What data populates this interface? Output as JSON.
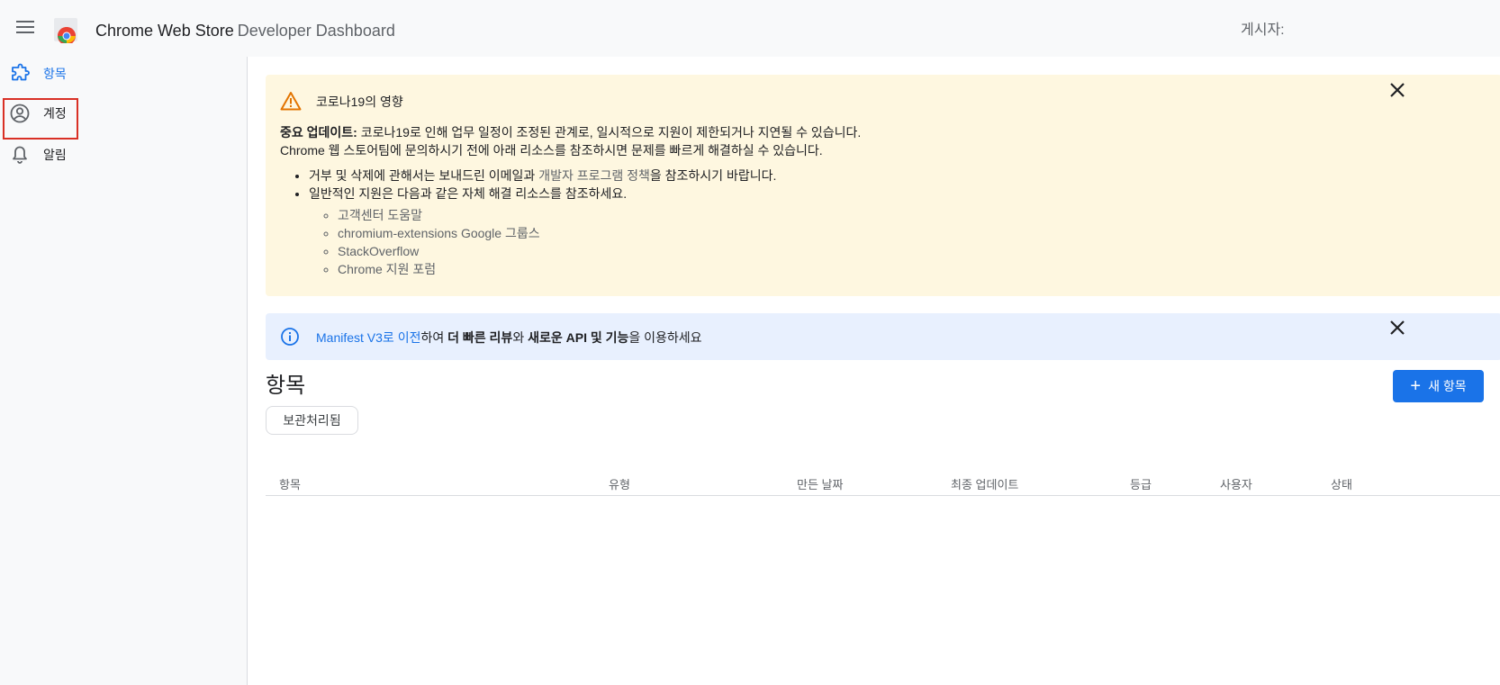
{
  "header": {
    "title": "Chrome Web Store",
    "subtitle": "Developer Dashboard",
    "publisher_label": "게시자:"
  },
  "sidebar": {
    "items": [
      {
        "label": "항목",
        "icon": "puzzle-icon",
        "active": true
      },
      {
        "label": "계정",
        "icon": "account-circle-icon",
        "active": false
      },
      {
        "label": "알림",
        "icon": "bell-icon",
        "active": false
      }
    ]
  },
  "covid_banner": {
    "title": "코로나19의 영향",
    "lead_bold": "중요 업데이트:",
    "lead_text": " 코로나19로 인해 업무 일정이 조정된 관계로, 일시적으로 지원이 제한되거나 지연될 수 있습니다.",
    "line2": "Chrome 웹 스토어팀에 문의하시기 전에 아래 리소스를 참조하시면 문제를 빠르게 해결하실 수 있습니다.",
    "bullet1_pre": "거부 및 삭제에 관해서는 보내드린 이메일과 ",
    "bullet1_link": "개발자 프로그램 정책",
    "bullet1_post": "을 참조하시기 바랍니다.",
    "bullet2": "일반적인 지원은 다음과 같은 자체 해결 리소스를 참조하세요.",
    "resources": [
      "고객센터 도움말",
      "chromium-extensions Google 그룹스",
      "StackOverflow",
      "Chrome 지원 포럼"
    ]
  },
  "mv3_banner": {
    "link": "Manifest V3로 이전",
    "text1": "하여 ",
    "bold1": "더 빠른 리뷰",
    "text2": "와 ",
    "bold2": "새로운 API 및 기능",
    "text3": "을 이용하세요"
  },
  "items_section": {
    "title": "항목",
    "new_item_label": "새 항목",
    "archived_label": "보관처리됨",
    "columns": [
      "항목",
      "유형",
      "만든 날짜",
      "최종 업데이트",
      "등급",
      "사용자",
      "상태"
    ]
  },
  "colors": {
    "accent": "#1a73e8",
    "warning_bg": "#fef7e0",
    "info_bg": "#e8f0fe",
    "highlight": "#d93025"
  }
}
